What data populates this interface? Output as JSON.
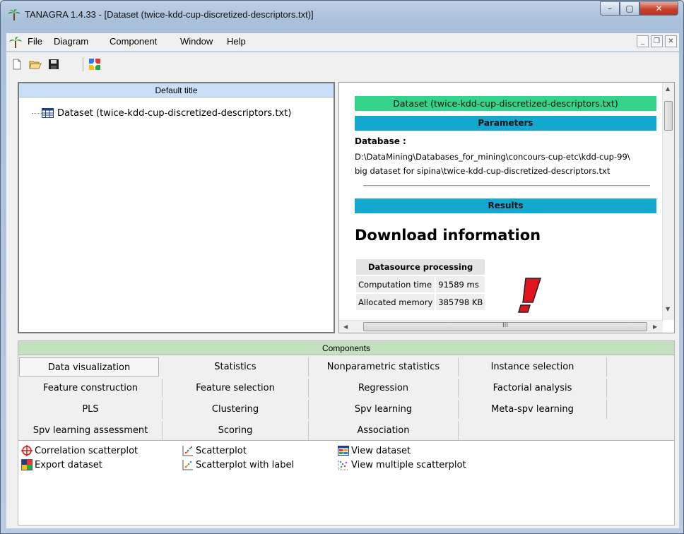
{
  "window": {
    "title": "TANAGRA 1.4.33 - [Dataset (twice-kdd-cup-discretized-descriptors.txt)]",
    "caption_buttons": {
      "minimize": "–",
      "maximize": "▢",
      "close": "✕"
    }
  },
  "menubar": {
    "items": [
      "File",
      "Diagram",
      "Component",
      "Window",
      "Help"
    ],
    "mdi_controls": {
      "minimize": "_",
      "restore": "❐",
      "close": "✕"
    }
  },
  "toolbar": {
    "icons": [
      "new-icon",
      "open-icon",
      "save-icon",
      "run-icon"
    ]
  },
  "diagram": {
    "title": "Default title",
    "node_label": "Dataset (twice-kdd-cup-discretized-descriptors.txt)"
  },
  "results": {
    "title_bar": "Dataset (twice-kdd-cup-discretized-descriptors.txt)",
    "parameters_bar": "Parameters",
    "database_label": "Database :",
    "database_path_lines": [
      "D:\\DataMining\\Databases_for_mining\\concours-cup-etc\\kdd-cup-99\\",
      "big dataset for sipina\\twice-kdd-cup-discretized-descriptors.txt"
    ],
    "results_bar": "Results",
    "download_title": "Download information",
    "table": {
      "header": "Datasource processing",
      "rows": [
        {
          "label": "Computation time",
          "value": "91589 ms"
        },
        {
          "label": "Allocated memory",
          "value": "385798 KB"
        }
      ]
    },
    "scroll_grip": "III"
  },
  "components": {
    "title": "Components",
    "tabs": [
      [
        "Data visualization",
        "Statistics",
        "Nonparametric statistics",
        "Instance selection"
      ],
      [
        "Feature construction",
        "Feature selection",
        "Regression",
        "Factorial analysis"
      ],
      [
        "PLS",
        "Clustering",
        "Spv learning",
        "Meta-spv learning"
      ],
      [
        "Spv learning assessment",
        "Scoring",
        "Association"
      ]
    ],
    "active_tab": "Data visualization",
    "items": [
      {
        "label": "Correlation scatterplot",
        "icon": "crosshair-icon"
      },
      {
        "label": "Scatterplot",
        "icon": "scatterplot-icon"
      },
      {
        "label": "View dataset",
        "icon": "view-dataset-icon"
      },
      {
        "label": "Export dataset",
        "icon": "export-icon"
      },
      {
        "label": "Scatterplot with label",
        "icon": "scatterplot-label-icon"
      },
      {
        "label": "View multiple scatterplot",
        "icon": "multiple-scatterplot-icon"
      }
    ]
  },
  "colors": {
    "title_bar_green": "#33d38a",
    "section_bar_blue": "#12a8cf",
    "diagram_header": "#c9def7",
    "components_header": "#c4e0c0",
    "warning_red": "#e0141e"
  }
}
